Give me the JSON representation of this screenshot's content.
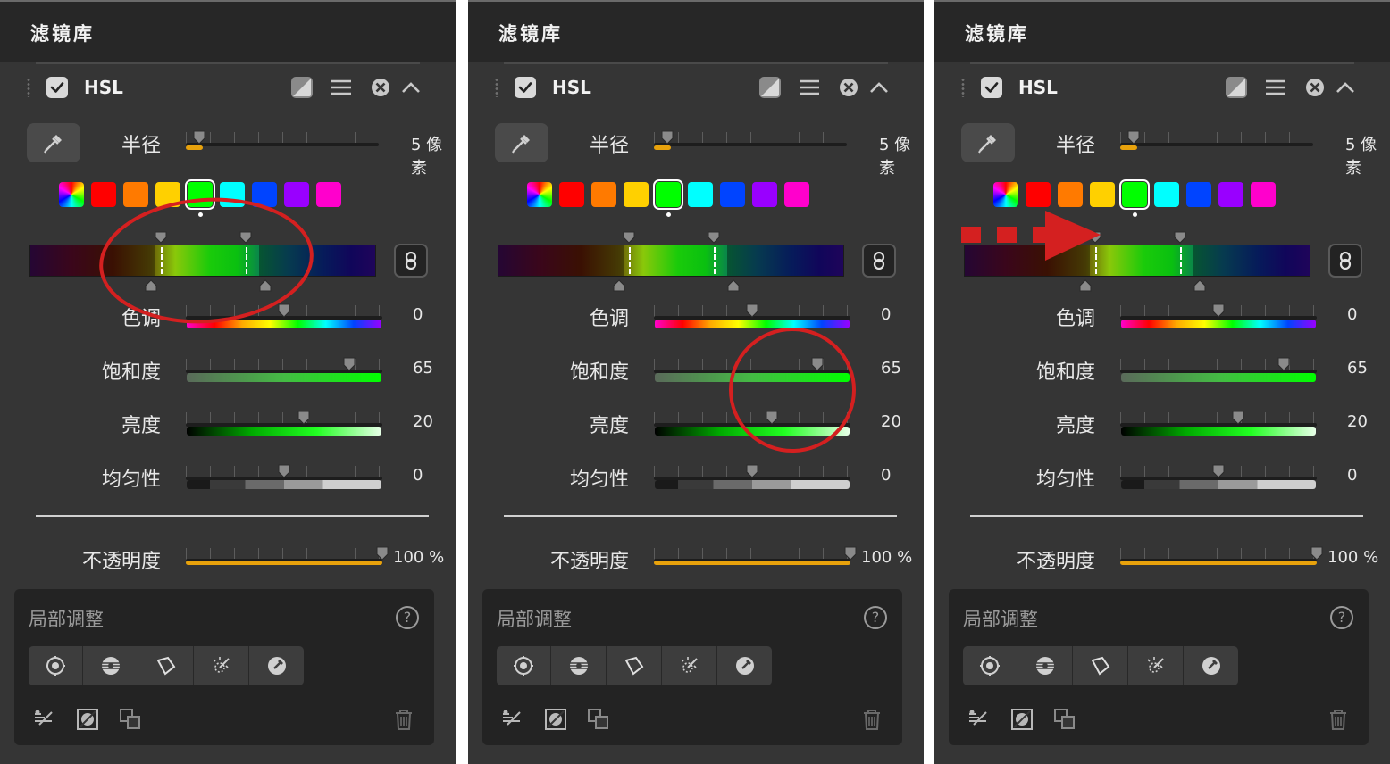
{
  "panels": [
    {
      "title": "滤镜库",
      "filter_name": "HSL",
      "radius_label": "半径",
      "radius_value": "5 像素",
      "hue_label": "色调",
      "hue_value": "0",
      "saturation_label": "饱和度",
      "saturation_value": "65",
      "lightness_label": "亮度",
      "lightness_value": "20",
      "uniformity_label": "均匀性",
      "uniformity_value": "0",
      "opacity_label": "不透明度",
      "opacity_value": "100 %",
      "local_title": "局部调整",
      "help_symbol": "?"
    },
    {
      "title": "滤镜库",
      "filter_name": "HSL",
      "radius_label": "半径",
      "radius_value": "5 像素",
      "hue_label": "色调",
      "hue_value": "0",
      "saturation_label": "饱和度",
      "saturation_value": "65",
      "lightness_label": "亮度",
      "lightness_value": "20",
      "uniformity_label": "均匀性",
      "uniformity_value": "0",
      "opacity_label": "不透明度",
      "opacity_value": "100 %",
      "local_title": "局部调整",
      "help_symbol": "?"
    },
    {
      "title": "滤镜库",
      "filter_name": "HSL",
      "radius_label": "半径",
      "radius_value": "5 像素",
      "hue_label": "色调",
      "hue_value": "0",
      "saturation_label": "饱和度",
      "saturation_value": "65",
      "lightness_label": "亮度",
      "lightness_value": "20",
      "uniformity_label": "均匀性",
      "uniformity_value": "0",
      "opacity_label": "不透明度",
      "opacity_value": "100 %",
      "local_title": "局部调整",
      "help_symbol": "?"
    }
  ],
  "slider_levels": {
    "radius": 0.07,
    "hue": 0.5,
    "saturation": 0.83,
    "lightness": 0.6,
    "uniformity": 0.5,
    "opacity": 1.0
  },
  "color_swatches": [
    "multicolor",
    "#ff0000",
    "#ff7a00",
    "#ffd000",
    "#00ff00",
    "#00ffff",
    "#0044ff",
    "#9900ff",
    "#ff00cc"
  ],
  "selected_swatch_index": 4,
  "accent_color": "#e8a20c",
  "annotation_color": "#d42020",
  "icons": {
    "checkbox": "checkmark-icon",
    "mask": "mask-icon",
    "menu": "menu-icon",
    "close": "close-circle-icon",
    "collapse": "chevron-up-icon",
    "picker": "eyedropper-icon",
    "link": "link-icon",
    "tools": [
      "radial-mask-icon",
      "gradient-mask-icon",
      "polygon-mask-icon",
      "magic-wand-icon",
      "color-range-icon"
    ],
    "bottom": [
      "brush-icon",
      "invert-mask-icon",
      "duplicate-icon",
      "trash-icon"
    ]
  }
}
